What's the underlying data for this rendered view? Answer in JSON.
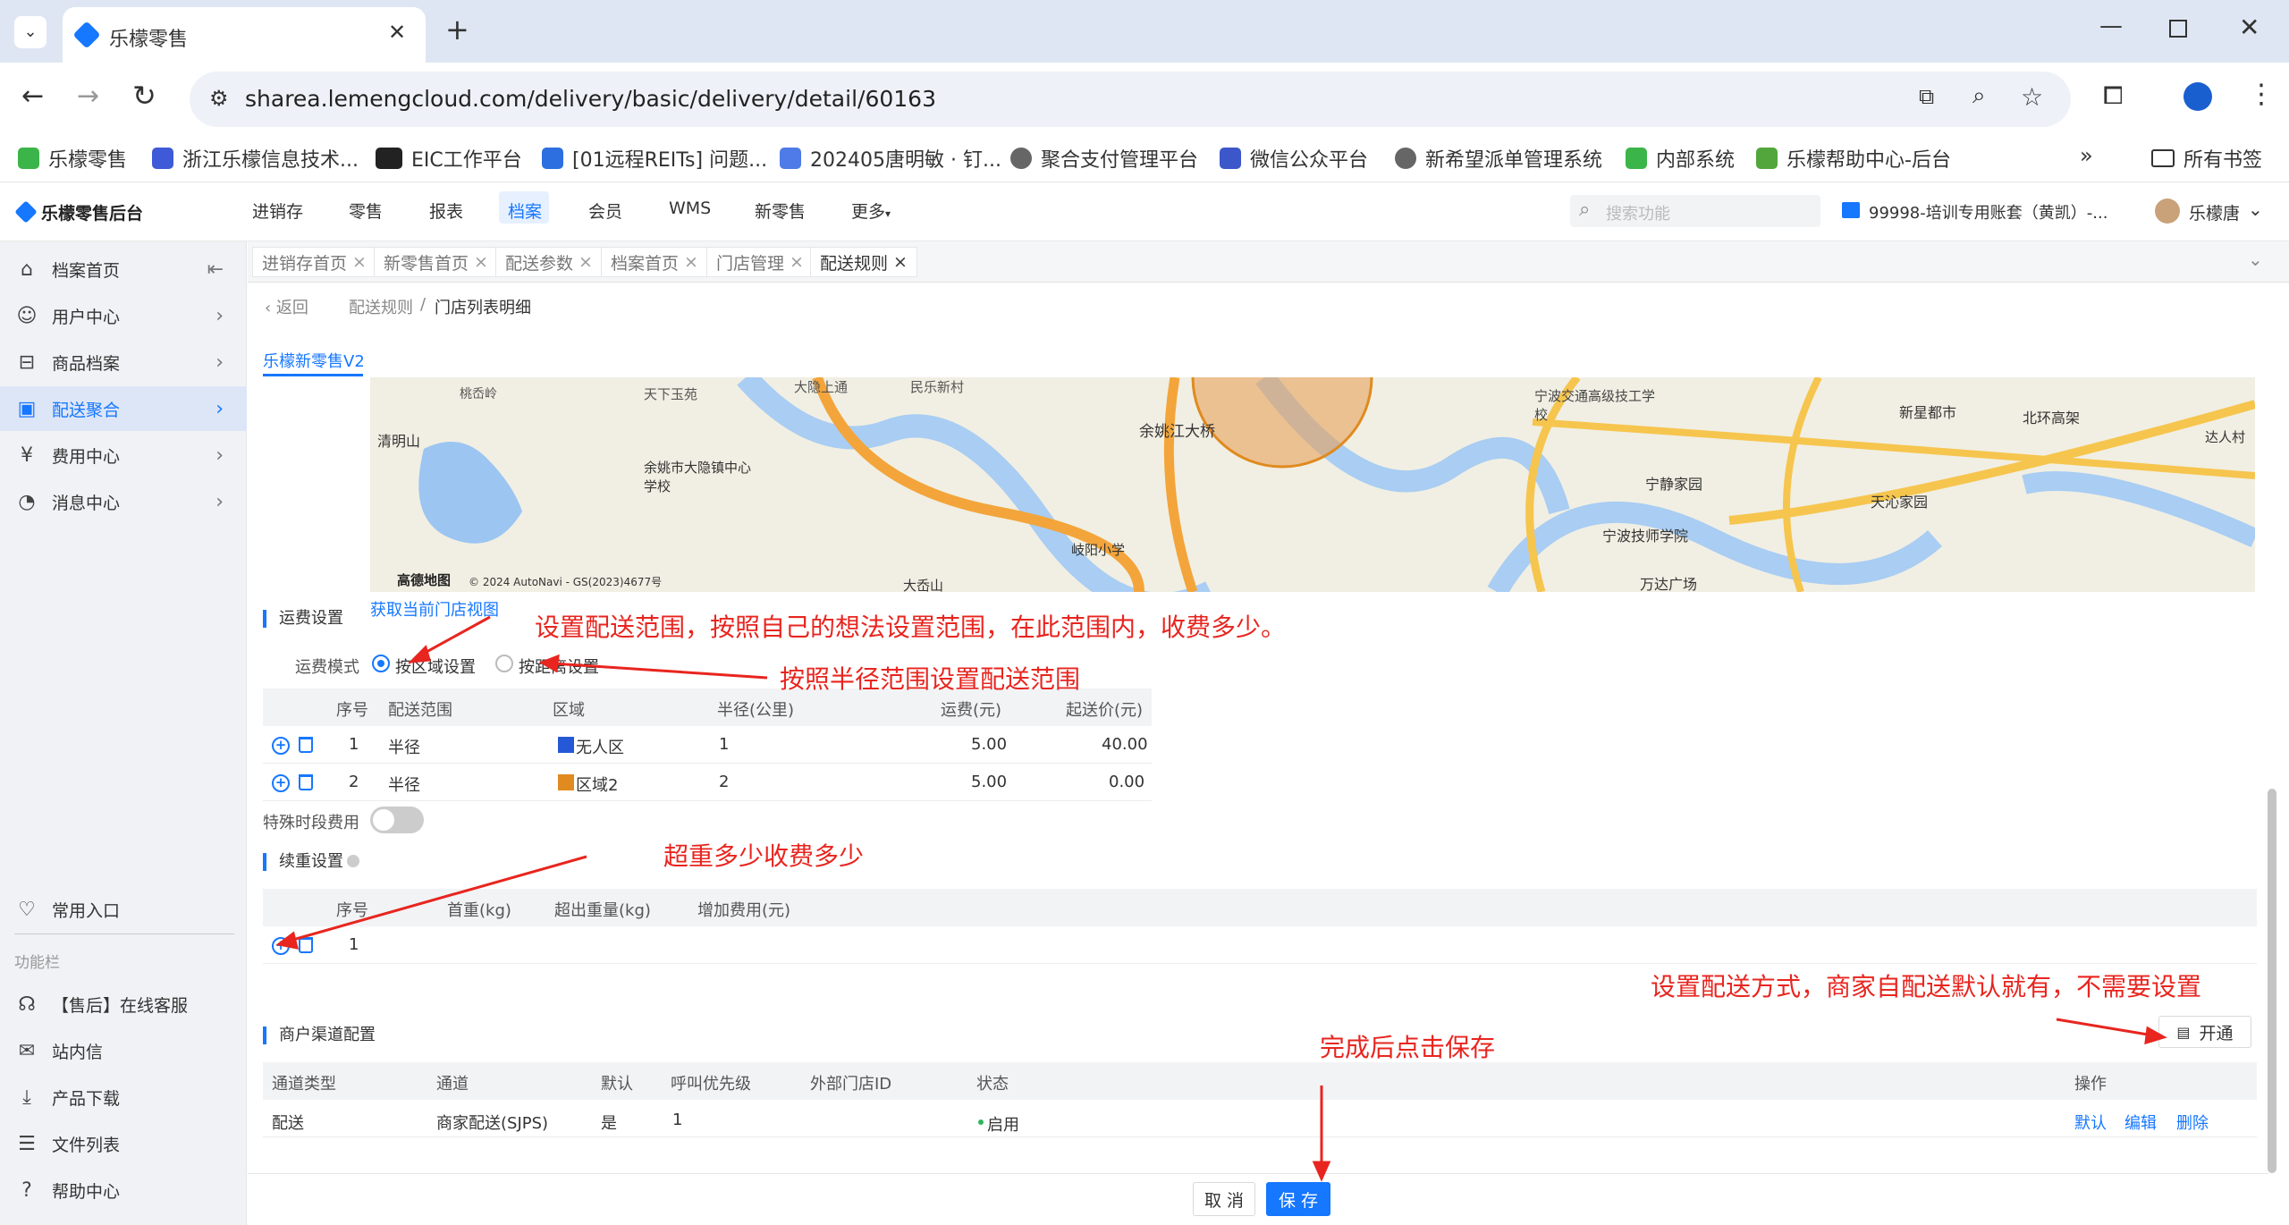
{
  "browser": {
    "tab_title": "乐檬零售",
    "url": "sharea.lemengcloud.com/delivery/basic/delivery/detail/60163",
    "bookmarks": [
      "乐檬零售",
      "浙江乐檬信息技术...",
      "EIC工作平台",
      "[01远程REITs] 问题...",
      "202405唐明敏 · 钉...",
      "聚合支付管理平台",
      "微信公众平台",
      "新希望派单管理系统",
      "内部系统",
      "乐檬帮助中心-后台"
    ],
    "all_bookmarks": "所有书签"
  },
  "app": {
    "logo": "乐檬零售后台",
    "nav": [
      "进销存",
      "零售",
      "报表",
      "档案",
      "会员",
      "WMS",
      "新零售",
      "更多"
    ],
    "search_placeholder": "搜索功能",
    "account": "99998-培训专用账套（黄凯）-...",
    "user": "乐檬唐"
  },
  "sidebar": {
    "items": [
      "档案首页",
      "用户中心",
      "商品档案",
      "配送聚合",
      "费用中心",
      "消息中心"
    ],
    "common": "常用入口",
    "func_title": "功能栏",
    "func_items": [
      "【售后】在线客服",
      "站内信",
      "产品下载",
      "文件列表",
      "帮助中心"
    ]
  },
  "tabs": [
    "进销存首页",
    "新零售首页",
    "配送参数",
    "档案首页",
    "门店管理",
    "配送规则"
  ],
  "breadcrumb": {
    "back": "返回",
    "parent": "配送规则",
    "current": "门店列表明细"
  },
  "store_tab": "乐檬新零售V2",
  "map": {
    "get_view": "获取当前门店视图",
    "copyright": "© 2024 AutoNavi - GS(2023)4677号",
    "brand": "高德地图",
    "labels": [
      "桃岙岭",
      "天下玉苑",
      "大隐上通",
      "民乐新村",
      "余姚江大桥",
      "宁波交通高级技工学校",
      "新星都市",
      "北环高架",
      "达人村",
      "清明山",
      "余姚市大隐镇中心学校",
      "岐阳小学",
      "宁静家园",
      "天沁家园",
      "宁波技师学院",
      "万达广场",
      "大岙山"
    ]
  },
  "freight": {
    "title": "运费设置",
    "mode_label": "运费模式",
    "mode_area": "按区域设置",
    "mode_distance": "按距离设置",
    "columns": [
      "序号",
      "配送范围",
      "区域",
      "半径(公里)",
      "运费(元)",
      "起送价(元)"
    ],
    "rows": [
      {
        "no": "1",
        "range": "半径",
        "area": "无人区",
        "area_color": "#2458d6",
        "radius": "1",
        "fee": "5.00",
        "min": "40.00"
      },
      {
        "no": "2",
        "range": "半径",
        "area": "区域2",
        "area_color": "#e08a1f",
        "radius": "2",
        "fee": "5.00",
        "min": "0.00"
      }
    ],
    "special_time": "特殊时段费用"
  },
  "weight": {
    "title": "续重设置",
    "columns": [
      "序号",
      "首重(kg)",
      "超出重量(kg)",
      "增加费用(元)"
    ],
    "row_no": "1"
  },
  "channel": {
    "title": "商户渠道配置",
    "open_button": "开通",
    "columns": [
      "通道类型",
      "通道",
      "默认",
      "呼叫优先级",
      "外部门店ID",
      "状态",
      "操作"
    ],
    "row": {
      "type": "配送",
      "channel": "商家配送(SJPS)",
      "default": "是",
      "priority": "1",
      "external_id": "",
      "status": "启用"
    },
    "actions": [
      "默认",
      "编辑",
      "删除"
    ]
  },
  "annotations": {
    "a1": "设置配送范围，按照自己的想法设置范围，在此范围内，收费多少。",
    "a2": "按照半径范围设置配送范围",
    "a3": "超重多少收费多少",
    "a4": "设置配送方式，商家自配送默认就有，不需要设置",
    "a5": "完成后点击保存"
  },
  "footer": {
    "cancel": "取 消",
    "save": "保 存"
  },
  "colors": {
    "accent": "#1677ff",
    "annotation": "#e8251f"
  }
}
